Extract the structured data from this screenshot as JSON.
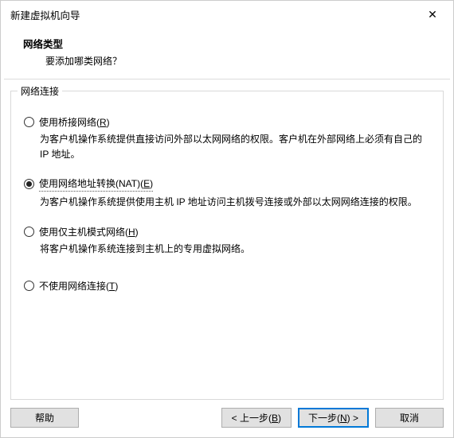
{
  "titlebar": {
    "title": "新建虚拟机向导",
    "close_glyph": "✕"
  },
  "header": {
    "title": "网络类型",
    "subtitle": "要添加哪类网络？"
  },
  "group": {
    "title": "网络连接"
  },
  "options": {
    "bridged": {
      "label_pre": "使用桥接网络(",
      "label_hot": "R",
      "label_post": ")",
      "desc": "为客户机操作系统提供直接访问外部以太网网络的权限。客户机在外部网络上必须有自己的 IP 地址。",
      "checked": false
    },
    "nat": {
      "label_pre": "使用网络地址转换(NAT)(",
      "label_hot": "E",
      "label_post": ")",
      "desc": "为客户机操作系统提供使用主机 IP 地址访问主机拨号连接或外部以太网网络连接的权限。",
      "checked": true
    },
    "hostonly": {
      "label_pre": "使用仅主机模式网络(",
      "label_hot": "H",
      "label_post": ")",
      "desc": "将客户机操作系统连接到主机上的专用虚拟网络。",
      "checked": false
    },
    "none": {
      "label_pre": "不使用网络连接(",
      "label_hot": "T",
      "label_post": ")",
      "desc": "",
      "checked": false
    }
  },
  "buttons": {
    "help": "帮助",
    "back_pre": "< 上一步(",
    "back_hot": "B",
    "back_post": ")",
    "next_pre": "下一步(",
    "next_hot": "N",
    "next_post": ") >",
    "cancel": "取消"
  }
}
